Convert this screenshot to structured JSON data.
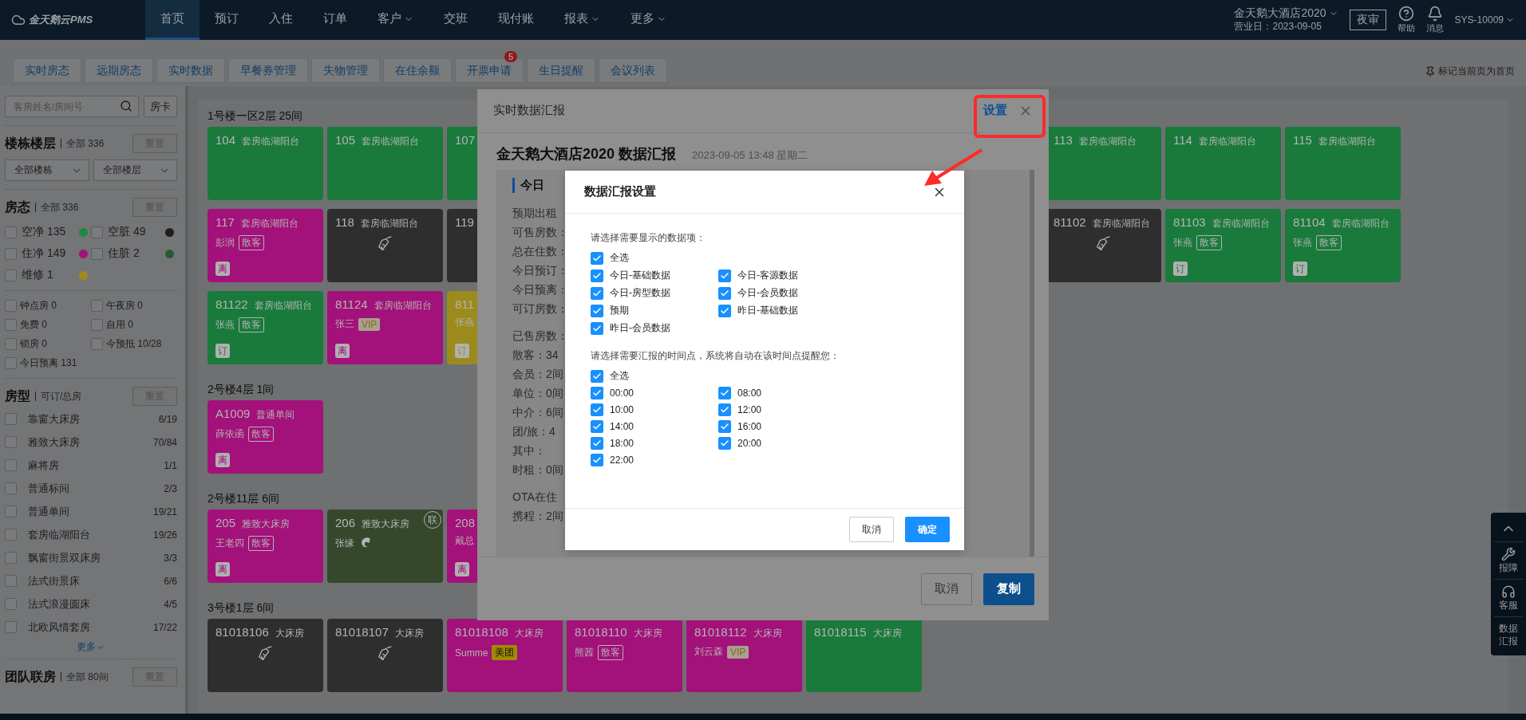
{
  "nav": {
    "logo": "金天鹅云PMS",
    "items": [
      {
        "label": "首页",
        "selected": true,
        "dropdown": false
      },
      {
        "label": "预订",
        "selected": false,
        "dropdown": false
      },
      {
        "label": "入住",
        "selected": false,
        "dropdown": false
      },
      {
        "label": "订单",
        "selected": false,
        "dropdown": false
      },
      {
        "label": "客户",
        "selected": false,
        "dropdown": true
      },
      {
        "label": "交班",
        "selected": false,
        "dropdown": false
      },
      {
        "label": "现付账",
        "selected": false,
        "dropdown": false
      },
      {
        "label": "报表",
        "selected": false,
        "dropdown": true
      },
      {
        "label": "更多",
        "selected": false,
        "dropdown": true
      }
    ],
    "hotel": "金天鹅大酒店2020",
    "business_day": "营业日：2023-09-05",
    "night_audit": "夜审",
    "help": "帮助",
    "messages": "消息",
    "user": "SYS-10009"
  },
  "tabs": {
    "items": [
      {
        "label": "实时房态"
      },
      {
        "label": "远期房态"
      },
      {
        "label": "实时数据"
      },
      {
        "label": "早餐券管理"
      },
      {
        "label": "失物管理"
      },
      {
        "label": "在住余额"
      },
      {
        "label": "开票申请",
        "badge": "5"
      },
      {
        "label": "生日提醒"
      },
      {
        "label": "会议列表"
      }
    ],
    "pin_home": "标记当前页为首页"
  },
  "sidebar": {
    "search": {
      "placeholder": "客房姓名/房间号"
    },
    "room_card": "房卡",
    "building": {
      "title": "楼栋楼层",
      "summary": "全部 336",
      "reset": "重置",
      "selects": [
        "全部楼栋",
        "全部楼层"
      ]
    },
    "status": {
      "title": "房态",
      "summary": "全部 336",
      "reset": "重置",
      "items": [
        {
          "label": "空净 135",
          "color": "#1a8a40",
          "checked": false
        },
        {
          "label": "空脏 49",
          "color": "#1e1e1e",
          "checked": false
        },
        {
          "label": "住净 149",
          "color": "#a3117a",
          "checked": false
        },
        {
          "label": "住脏 2",
          "color": "#285a33",
          "checked": false
        },
        {
          "label": "维修 1",
          "color": "#a08c1e",
          "checked": false
        }
      ],
      "flags": [
        {
          "label": "钟点房 0",
          "checked": false
        },
        {
          "label": "午夜房 0",
          "checked": false
        },
        {
          "label": "免费 0",
          "checked": false
        },
        {
          "label": "自用 0",
          "checked": false
        },
        {
          "label": "锁房 0",
          "checked": false
        },
        {
          "label": "今预抵 10/28",
          "checked": false
        },
        {
          "label": "今日预离 131",
          "checked": false
        }
      ]
    },
    "room_types": {
      "title": "房型",
      "summary": "可订/总房",
      "reset": "重置",
      "items": [
        {
          "name": "靠窗大床房",
          "count": "6/19",
          "checked": false
        },
        {
          "name": "雅致大床房",
          "count": "70/84",
          "checked": false
        },
        {
          "name": "麻将房",
          "count": "1/1",
          "checked": false
        },
        {
          "name": "普通标间",
          "count": "2/3",
          "checked": false
        },
        {
          "name": "普通单间",
          "count": "19/21",
          "checked": false
        },
        {
          "name": "套房临湖阳台",
          "count": "19/26",
          "checked": false
        },
        {
          "name": "飘窗街景双床房",
          "count": "3/3",
          "checked": false
        },
        {
          "name": "法式街景床",
          "count": "6/6",
          "checked": false
        },
        {
          "name": "法式浪漫圆床",
          "count": "4/5",
          "checked": false
        },
        {
          "name": "北欧风情套房",
          "count": "17/22",
          "checked": false
        }
      ],
      "more": "更多"
    },
    "groups": {
      "title": "团队联房",
      "summary": "全部 80间",
      "reset": "重置"
    }
  },
  "floors": [
    {
      "title": "1号楼一区2层 25间",
      "rows": [
        {
          "left": [
            {
              "number": "104",
              "type": "套房临湖阳台",
              "color": "#197a3c"
            },
            {
              "number": "105",
              "type": "套房临湖阳台",
              "color": "#197a3c"
            },
            {
              "number": "107",
              "color": "#197a3c"
            }
          ],
          "right": [
            {
              "number": "113",
              "type": "套房临湖阳台",
              "color": "#197a3c"
            },
            {
              "number": "114",
              "type": "套房临湖阳台",
              "color": "#197a3c"
            },
            {
              "number": "115",
              "type": "套房临湖阳台",
              "color": "#197a3c"
            }
          ]
        },
        {
          "left": [
            {
              "number": "117",
              "type": "套房临湖阳台",
              "color": "#a3117a",
              "guest": "彭润",
              "tag": {
                "text": "散客",
                "kind": "plain"
              },
              "mark": "离"
            },
            {
              "number": "118",
              "type": "套房临湖阳台",
              "color": "#2e2e2e",
              "broom": true
            },
            {
              "number": "119",
              "color": "#2e2e2e"
            }
          ],
          "right": [
            {
              "number": "81102",
              "type": "套房临湖阳台",
              "color": "#2e2e2e",
              "broom": true
            },
            {
              "number": "81103",
              "type": "套房临湖阳台",
              "color": "#197a3c",
              "guest": "张燕",
              "tag": {
                "text": "散客",
                "kind": "plain"
              },
              "mark": "订"
            },
            {
              "number": "81104",
              "type": "套房临湖阳台",
              "color": "#197a3c",
              "guest": "张燕",
              "tag": {
                "text": "散客",
                "kind": "plain"
              },
              "mark": "订"
            }
          ]
        },
        {
          "left": [
            {
              "number": "81122",
              "type": "套房临湖阳台",
              "color": "#197a3c",
              "guest": "张燕",
              "tag": {
                "text": "散客",
                "kind": "plain"
              },
              "mark": "订"
            },
            {
              "number": "81124",
              "type": "套房临湖阳台",
              "color": "#a3117a",
              "guest": "张三",
              "tag": {
                "text": "VIP",
                "kind": "vip"
              },
              "mark": "离"
            },
            {
              "number": "811",
              "color": "#9c8a1c",
              "guest": "张燕",
              "mark": "订"
            }
          ]
        }
      ]
    },
    {
      "title": "2号楼4层 1间",
      "rows": [
        {
          "left": [
            {
              "number": "A1009",
              "type": "普通单间",
              "color": "#a3117a",
              "guest": "薛依函",
              "tag": {
                "text": "散客",
                "kind": "plain"
              },
              "mark": "离"
            }
          ]
        }
      ]
    },
    {
      "title": "2号楼11层 6间",
      "rows": [
        {
          "left": [
            {
              "number": "205",
              "type": "雅致大床房",
              "color": "#a3117a",
              "guest": "王老四",
              "tag": {
                "text": "散客",
                "kind": "plain"
              },
              "mark": "离"
            },
            {
              "number": "206",
              "type": "雅致大床房",
              "color": "#35482c",
              "guest": "张缘",
              "channel_icon": true,
              "linked": "联"
            },
            {
              "number": "208",
              "color": "#a3117a",
              "guest": "戴总",
              "mark": "离"
            }
          ]
        }
      ]
    },
    {
      "title": "3号楼1层 6间",
      "rows": [
        {
          "left": [
            {
              "number": "81018106",
              "type": "大床房",
              "color": "#2e2e2e",
              "broom": true
            },
            {
              "number": "81018107",
              "type": "大床房",
              "color": "#2e2e2e",
              "broom": true
            },
            {
              "number": "81018108",
              "type": "大床房",
              "color": "#a3117a",
              "guest": "Summe",
              "tag": {
                "text": "美团",
                "kind": "meituan"
              }
            },
            {
              "number": "81018110",
              "type": "大床房",
              "color": "#a3117a",
              "guest": "熊茜",
              "tag": {
                "text": "散客",
                "kind": "plain"
              }
            },
            {
              "number": "81018112",
              "type": "大床房",
              "color": "#a3117a",
              "guest": "刘云森",
              "tag": {
                "text": "VIP",
                "kind": "vip"
              }
            },
            {
              "number": "81018115",
              "type": "大床房",
              "color": "#197a3c"
            }
          ]
        }
      ]
    }
  ],
  "float_bar": [
    {
      "kind": "up"
    },
    {
      "kind": "wrench",
      "label": "报障"
    },
    {
      "kind": "headset",
      "label": "客服"
    },
    {
      "kind": "text",
      "label": "数据汇报"
    }
  ],
  "report_dialog": {
    "title": "实时数据汇报",
    "settings": "设置",
    "heading": "金天鹅大酒店2020 数据汇报",
    "timestamp": "2023-09-05 13:48 星期二",
    "groups": [
      {
        "heading": "今日",
        "lines": [
          "预期出租",
          "可售房数：",
          "总在住数：",
          "今日预订：",
          "今日预离：",
          "可订房数："
        ]
      },
      {
        "lines": [
          "已售房数：",
          "散客：34",
          "会员：2间",
          "单位：0间",
          "中介：6间",
          "团/旅：4",
          "其中：",
          "时租：0间"
        ]
      },
      {
        "lines": [
          "OTA在住",
          "携程：2间"
        ]
      }
    ],
    "buttons": [
      {
        "label": "取消",
        "primary": false
      },
      {
        "label": "复制",
        "primary": true
      }
    ]
  },
  "settings_dialog": {
    "title": "数据汇报设置",
    "sections": [
      {
        "prompt": "请选择需要显示的数据项：",
        "select_all": {
          "label": "全选",
          "checked": true
        },
        "options": [
          {
            "label": "今日-基础数据",
            "checked": true
          },
          {
            "label": "今日-客源数据",
            "checked": true
          },
          {
            "label": "今日-房型数据",
            "checked": true
          },
          {
            "label": "今日-会员数据",
            "checked": true
          },
          {
            "label": "预期",
            "checked": true
          },
          {
            "label": "昨日-基础数据",
            "checked": true
          },
          {
            "label": "昨日-会员数据",
            "checked": true
          }
        ]
      },
      {
        "prompt": "请选择需要汇报的时间点，系统将自动在该时间点提醒您：",
        "select_all": {
          "label": "全选",
          "checked": true
        },
        "options": [
          {
            "label": "00:00",
            "checked": true
          },
          {
            "label": "08:00",
            "checked": true
          },
          {
            "label": "10:00",
            "checked": true
          },
          {
            "label": "12:00",
            "checked": true
          },
          {
            "label": "14:00",
            "checked": true
          },
          {
            "label": "16:00",
            "checked": true
          },
          {
            "label": "18:00",
            "checked": true
          },
          {
            "label": "20:00",
            "checked": true
          },
          {
            "label": "22:00",
            "checked": true
          }
        ]
      }
    ],
    "buttons": [
      {
        "label": "取消",
        "primary": false
      },
      {
        "label": "确定",
        "primary": true
      }
    ]
  }
}
